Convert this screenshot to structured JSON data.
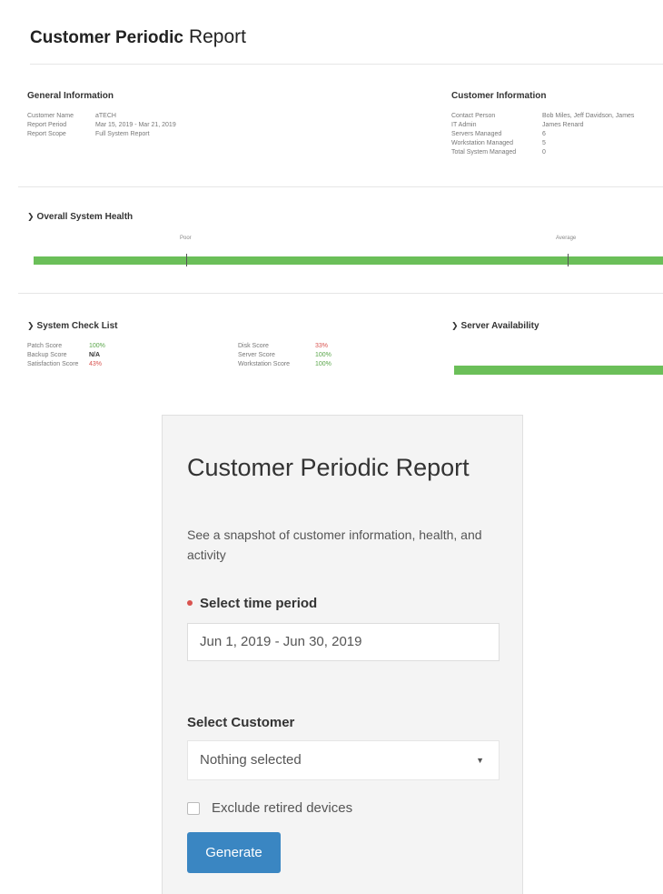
{
  "report": {
    "title_bold": "Customer Periodic",
    "title_light": "Report",
    "general_info": {
      "heading": "General Information",
      "rows": [
        {
          "key": "Customer Name",
          "value": "aTECH"
        },
        {
          "key": "Report Period",
          "value": "Mar 15, 2019 - Mar 21, 2019"
        },
        {
          "key": "Report Scope",
          "value": "Full System Report"
        }
      ]
    },
    "customer_info": {
      "heading": "Customer Information",
      "rows": [
        {
          "key": "Contact Person",
          "value": "Bob Miles, Jeff Davidson, James"
        },
        {
          "key": "IT Admin",
          "value": "James Renard"
        },
        {
          "key": "Servers Managed",
          "value": "6"
        },
        {
          "key": "Workstation Managed",
          "value": "5"
        },
        {
          "key": "Total System Managed",
          "value": "0"
        }
      ]
    },
    "health": {
      "heading": "Overall System Health",
      "marker_left": "Poor",
      "marker_right": "Average",
      "level": 1.0
    },
    "checklist": {
      "heading": "System Check List",
      "col1": [
        {
          "key": "Patch Score",
          "value": "100%",
          "color": "green"
        },
        {
          "key": "Backup Score",
          "value": "N/A",
          "color": "dark"
        },
        {
          "key": "Satisfaction Score",
          "value": "43%",
          "color": "red"
        }
      ],
      "col2": [
        {
          "key": "Disk Score",
          "value": "33%",
          "color": "red"
        },
        {
          "key": "Server Score",
          "value": "100%",
          "color": "green"
        },
        {
          "key": "Workstation Score",
          "value": "100%",
          "color": "green"
        }
      ]
    },
    "availability": {
      "heading": "Server Availability",
      "level": 1.0
    }
  },
  "card": {
    "title": "Customer Periodic Report",
    "description": "See a snapshot of customer information, health, and activity",
    "time_label": "Select time period",
    "time_value": "Jun 1, 2019 - Jun 30, 2019",
    "customer_label": "Select Customer",
    "customer_value": "Nothing selected",
    "exclude_label": "Exclude retired devices",
    "button_label": "Generate"
  },
  "colors": {
    "bar_green": "#6bbf59",
    "button_blue": "#3a86c2",
    "required_red": "#d9534f"
  }
}
